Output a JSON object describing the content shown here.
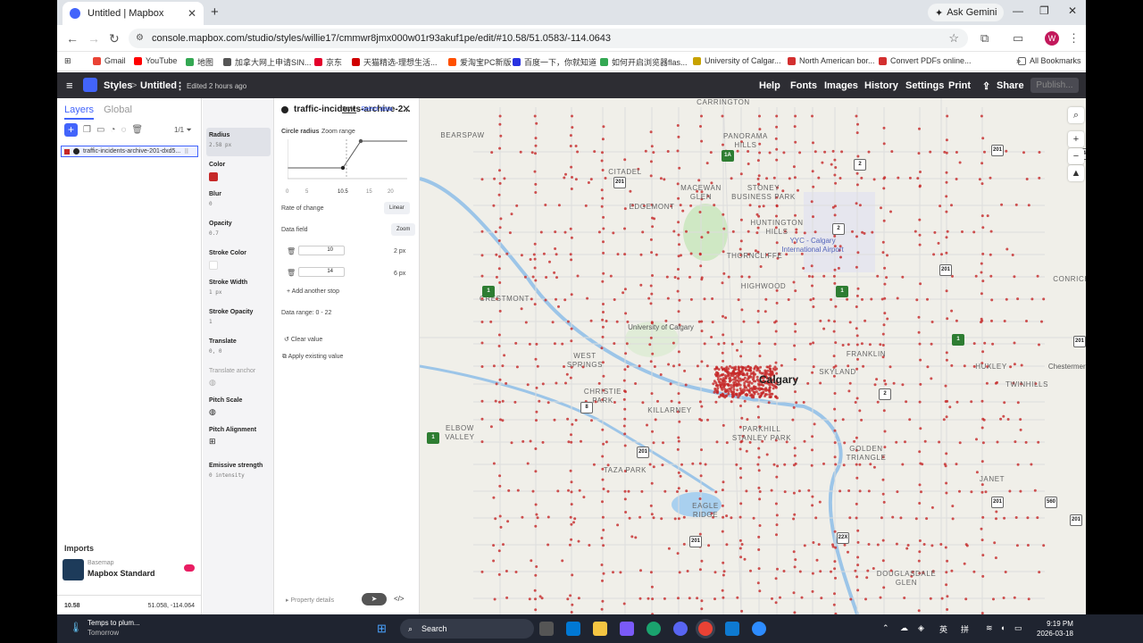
{
  "browser": {
    "tab_title": "Untitled | Mapbox",
    "new_tab": "+",
    "ask_gemini": "Ask Gemini",
    "url": "console.mapbox.com/studio/styles/willie17/cmmwr8jmx000w01r93akuf1pe/edit/#10.58/51.0583/-114.0643",
    "profile_initial": "W",
    "bookmarks": [
      "Gmail",
      "YouTube",
      "地图",
      "加拿大网上申请SIN...",
      "京东",
      "天猫精选-理想生活...",
      "爱淘宝PC新版",
      "百度一下，你就知道",
      "如何开启浏览器flas...",
      "University of Calgar...",
      "North American bor...",
      "Convert PDFs online..."
    ],
    "all_bookmarks": "All Bookmarks",
    "bookmark_colors": [
      "#ea4335",
      "#ff0000",
      "#34a853",
      "#555555",
      "#e4002b",
      "#d00000",
      "#ff5000",
      "#2932e1",
      "#34a853",
      "#c8a200",
      "#d32f2f",
      "#d32f2f"
    ]
  },
  "header": {
    "styles": "Styles",
    "breadcrumb_sep": ">",
    "title": "Untitled",
    "edited": "Edited 2 hours ago",
    "nav": [
      "Help",
      "Fonts",
      "Images",
      "History",
      "Settings",
      "Print",
      "Share"
    ],
    "publish": "Publish..."
  },
  "layers": {
    "tabs": [
      "Layers",
      "Global"
    ],
    "count": "1/1",
    "layer_name": "traffic-incidents-archive-201-dxd5...",
    "imports_label": "Imports",
    "basemap_label": "Basemap",
    "basemap_name": "Mapbox Standard",
    "zoom": "10.58",
    "coords": "51.058, -114.064"
  },
  "properties": [
    {
      "name": "Radius",
      "value": "2.58 px"
    },
    {
      "name": "Color",
      "value": ""
    },
    {
      "name": "Blur",
      "value": "0"
    },
    {
      "name": "Opacity",
      "value": "0.7"
    },
    {
      "name": "Stroke Color",
      "value": ""
    },
    {
      "name": "Stroke Width",
      "value": "1 px"
    },
    {
      "name": "Stroke Opacity",
      "value": "1"
    },
    {
      "name": "Translate",
      "value": "0, 0"
    },
    {
      "name": "Translate anchor",
      "value": ""
    },
    {
      "name": "Pitch Scale",
      "value": ""
    },
    {
      "name": "Pitch Alignment",
      "value": ""
    },
    {
      "name": "Emissive strength",
      "value": "0 intensity"
    }
  ],
  "colors": {
    "layer_color": "#c62828",
    "accent": "#4264fb"
  },
  "editor": {
    "title": "traffic-incidents-archive-2...",
    "tab_style": "Style",
    "tab_select_data": "Select data",
    "circle_radius": "Circle radius",
    "zoom_range": "Zoom range",
    "axis_ticks": [
      "0",
      "5",
      "10.5",
      "15",
      "20"
    ],
    "rate_label": "Rate of change",
    "rate_value": "Linear",
    "data_field_label": "Data field",
    "data_field_value": "Zoom",
    "stops": [
      {
        "input": "10",
        "output": "2 px"
      },
      {
        "input": "14",
        "output": "6 px"
      }
    ],
    "add_stop": "Add another stop",
    "data_range": "Data range: 0 - 22",
    "clear_value": "Clear value",
    "apply_existing": "Apply existing value",
    "property_details": "Property details"
  },
  "map": {
    "labels": [
      "BEARSPAW",
      "CARRINGTON",
      "PANORAMA HILLS",
      "CITADEL",
      "MACEWAN GLEN",
      "STONEY BUSINESS PARK",
      "EDGEMONT",
      "HUNTINGTON HILLS",
      "YYC - Calgary International Airport",
      "THORNCLIFFE",
      "CRESTMONT",
      "HIGHWOOD",
      "University of Calgary",
      "CONRICH",
      "WEST SPRINGS",
      "FRANKLIN",
      "HUXLEY",
      "Chestermere",
      "CHRISTIE PARK",
      "Calgary",
      "TWINHILLS",
      "KILLARNEY",
      "ELBOW VALLEY",
      "PARKHILL STANLEY PARK",
      "GOLDEN TRIANGLE",
      "TAZA PARK",
      "JANET",
      "EAGLE RIDGE",
      "DOUGLASDALE GLEN",
      "SKYLAND"
    ],
    "shields": [
      "201",
      "1A",
      "2",
      "201",
      "564",
      "1",
      "201",
      "1",
      "1",
      "201",
      "8",
      "2",
      "1",
      "201",
      "201",
      "22X",
      "201",
      "201",
      "560",
      "2"
    ]
  },
  "taskbar": {
    "weather_line1": "Temps to plum...",
    "weather_line2": "Tomorrow",
    "search": "Search",
    "time": "9:19 PM",
    "date": "2026-03-18",
    "ime1": "英",
    "ime2": "拼"
  }
}
